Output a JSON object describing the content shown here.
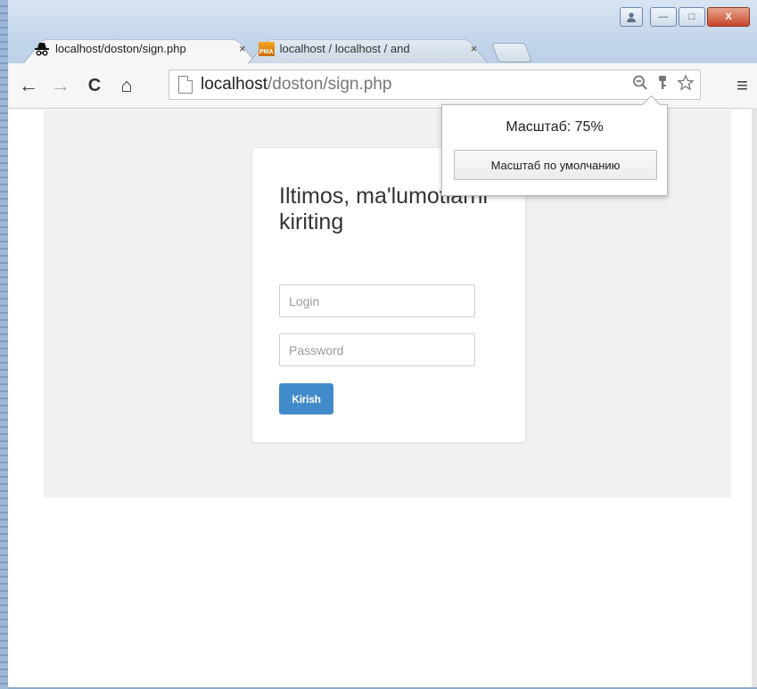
{
  "window": {
    "minimize_label": "—",
    "restore_label": "□",
    "close_label": "X"
  },
  "tabs": [
    {
      "title": "localhost/doston/sign.php",
      "close": "×",
      "favicon": "incognito-hat-icon"
    },
    {
      "title": "localhost / localhost / and",
      "close": "×",
      "favicon": "phpmyadmin-icon",
      "favicon_text": "PMA"
    }
  ],
  "toolbar": {
    "back": "←",
    "forward": "→",
    "reload": "C",
    "home": "⌂",
    "url_host": "localhost",
    "url_path": "/doston/sign.php",
    "menu": "≡"
  },
  "zoom_popup": {
    "label": "Масштаб: 75%",
    "reset_button": "Масштаб по умолчанию"
  },
  "form": {
    "heading": "Iltimos, ma'lumotlarni kiriting",
    "login_placeholder": "Login",
    "password_placeholder": "Password",
    "submit_label": "Kirish"
  },
  "colors": {
    "button_primary": "#428bca",
    "page_background": "#f1f1f1"
  }
}
